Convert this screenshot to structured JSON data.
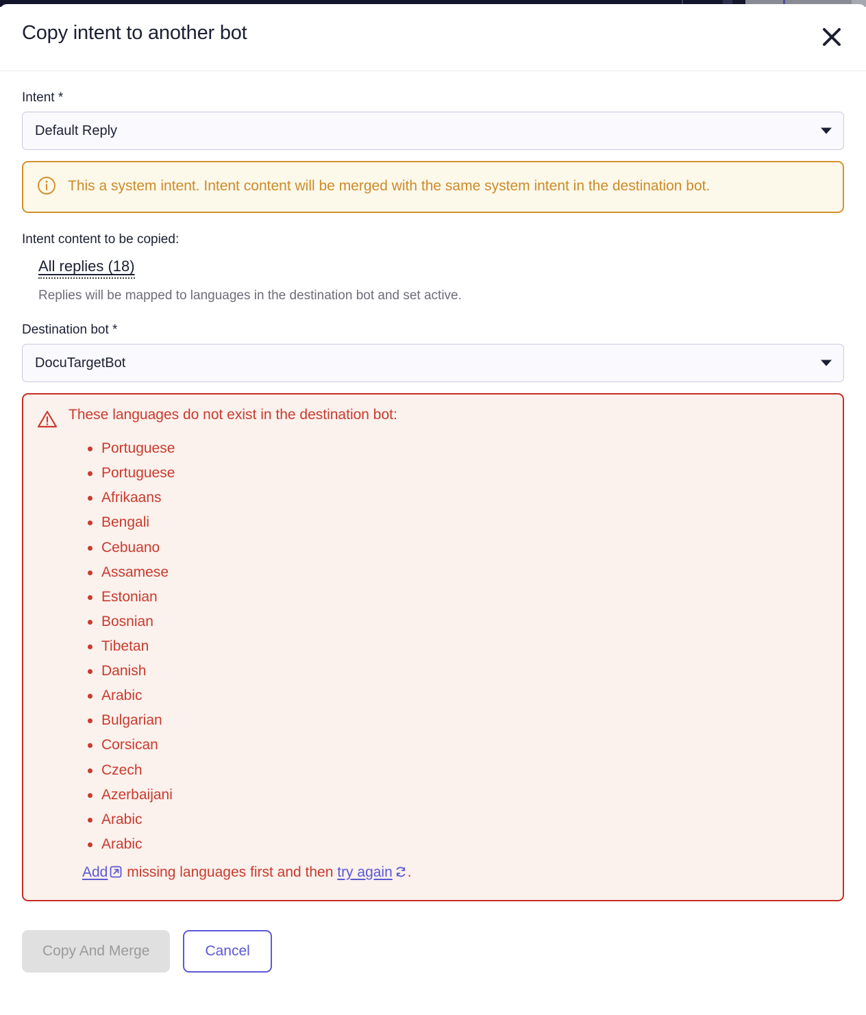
{
  "dialog": {
    "title": "Copy intent to another bot",
    "close_icon": "close-icon"
  },
  "intent_field": {
    "label": "Intent *",
    "value": "Default Reply"
  },
  "info_banner": {
    "icon": "info-circle-icon",
    "text": "This a system intent. Intent content will be merged with the same system intent in the destination bot.",
    "color": "#cc8b28",
    "background": "#fcf8ea"
  },
  "intent_content": {
    "label": "Intent content to be copied:",
    "all_replies_label": "All replies (18)",
    "note": "Replies will be mapped to languages in the destination bot and set active."
  },
  "destination_field": {
    "label": "Destination bot *",
    "value": "DocuTargetBot"
  },
  "error_banner": {
    "icon": "warning-triangle-icon",
    "title": "These languages do not exist in the destination bot:",
    "color": "#c93b2e",
    "background": "#fbf1ed",
    "languages": [
      "Portuguese",
      "Portuguese",
      "Afrikaans",
      "Bengali",
      "Cebuano",
      "Assamese",
      "Estonian",
      "Bosnian",
      "Tibetan",
      "Danish",
      "Arabic",
      "Bulgarian",
      "Corsican",
      "Czech",
      "Azerbaijani",
      "Arabic",
      "Arabic"
    ],
    "footer": {
      "add_link": "Add",
      "add_icon": "external-link-icon",
      "middle_text": " missing languages first and then ",
      "retry_link": "try again",
      "retry_icon": "refresh-icon",
      "trailing_text": "."
    }
  },
  "actions": {
    "primary_label": "Copy And Merge",
    "secondary_label": "Cancel",
    "accent_color": "#5b58d6"
  }
}
